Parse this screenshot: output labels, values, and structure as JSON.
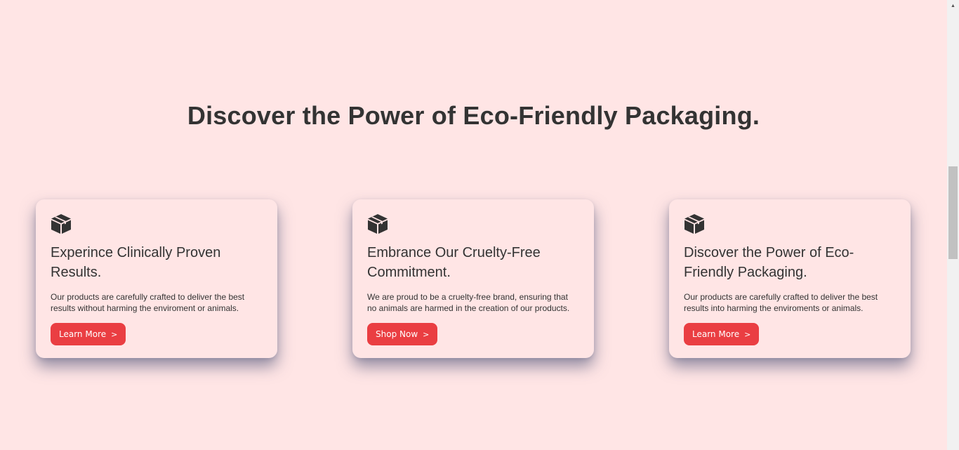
{
  "section": {
    "heading": "Discover the Power of Eco-Friendly Packaging."
  },
  "cards": [
    {
      "icon": "box-icon",
      "title": "Experince Clinically Proven Results.",
      "text": "Our products are carefully crafted to deliver the best results without harming the enviroment or animals.",
      "button_label": "Learn More"
    },
    {
      "icon": "box-icon",
      "title": "Embrance Our Cruelty-Free Commitment.",
      "text": "We are proud to be a cruelty-free brand, ensuring that no animals are harmed in the creation of our products.",
      "button_label": "Shop Now"
    },
    {
      "icon": "box-icon",
      "title": "Discover the Power of Eco-Friendly Packaging.",
      "text": "Our products are carefully crafted to deliver the best results into harming the enviroments or animals.",
      "button_label": "Learn More"
    }
  ],
  "colors": {
    "background": "#ffe5e5",
    "accent": "#ea3e42",
    "text": "#333333"
  },
  "scrollbar": {
    "up_arrow_icon": "chevron-up-icon"
  }
}
